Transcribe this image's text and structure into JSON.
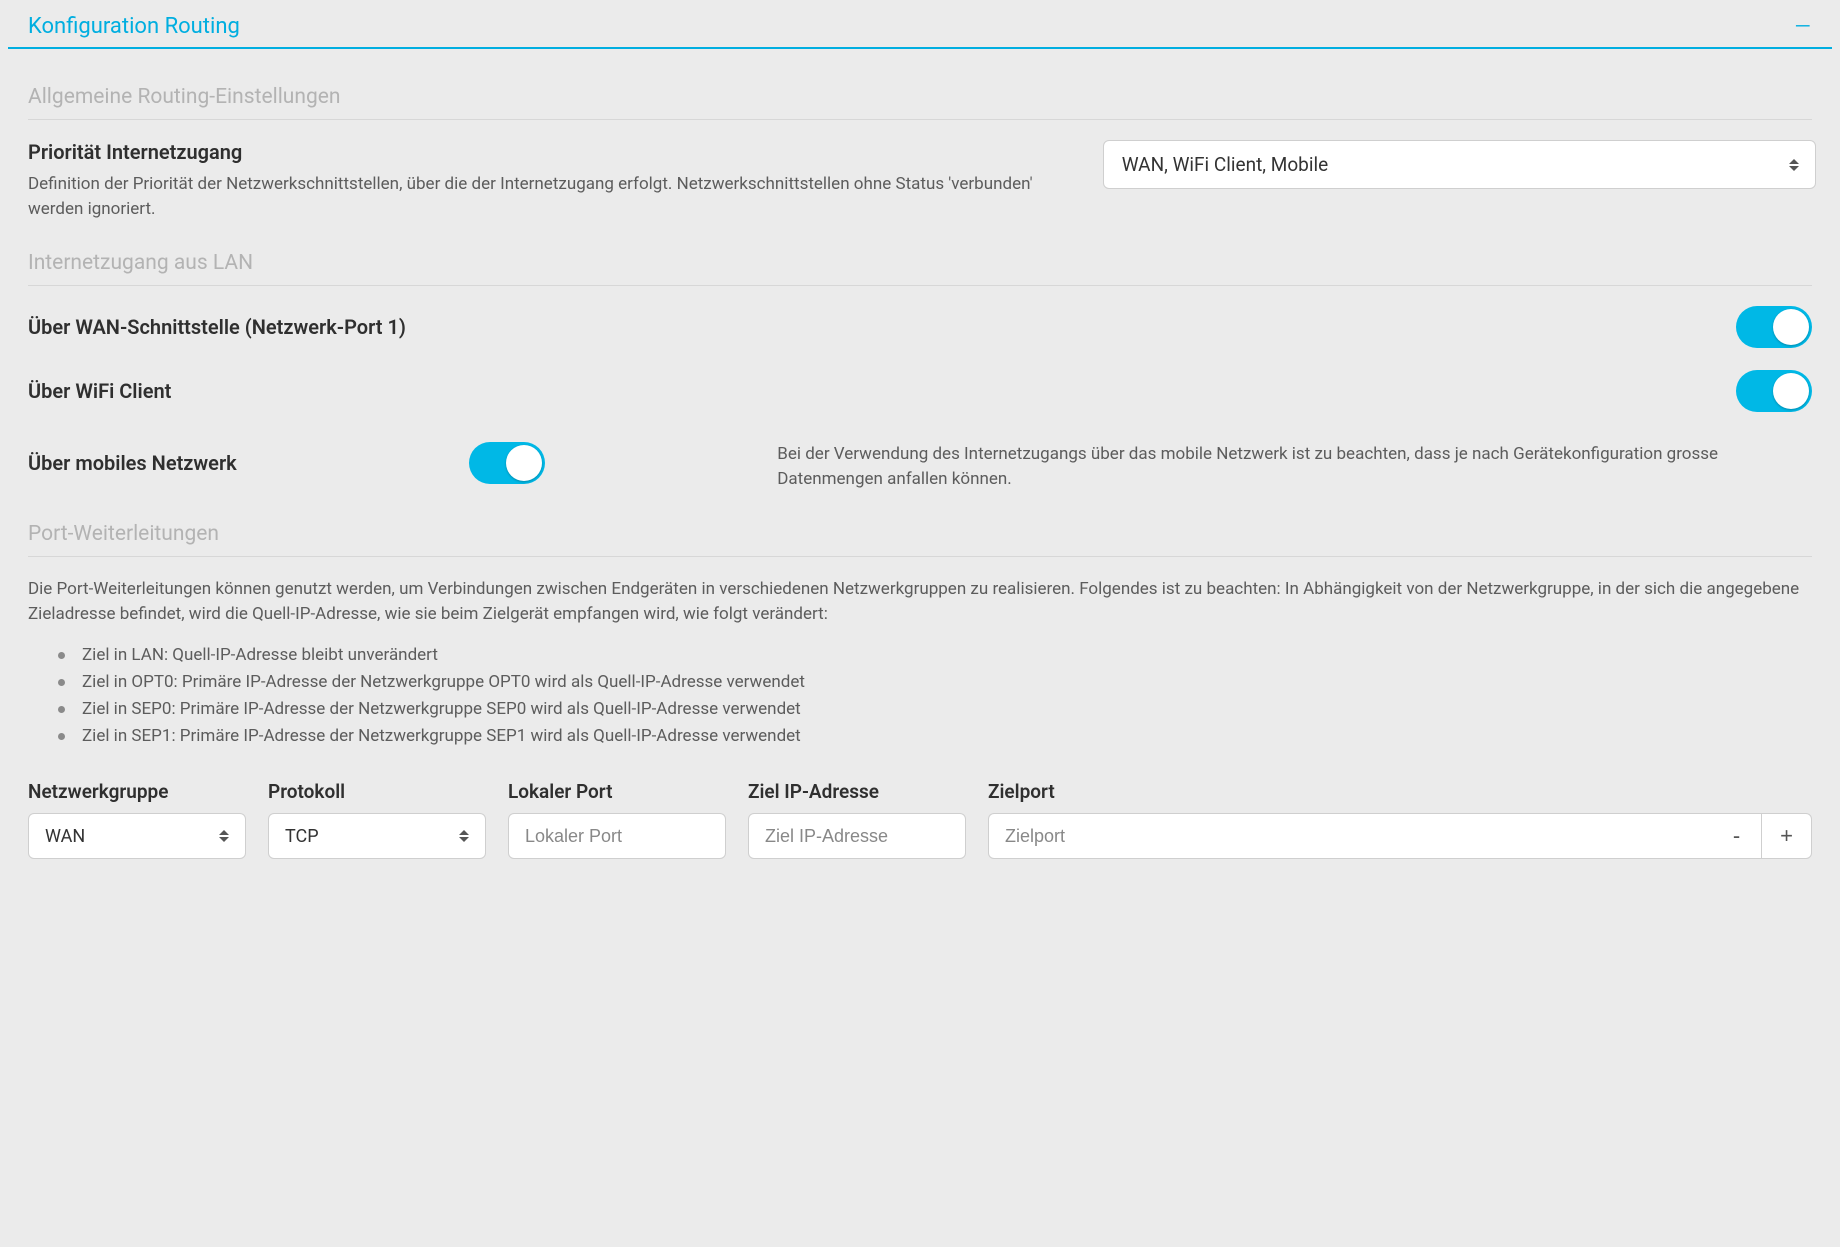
{
  "panel": {
    "title": "Konfiguration Routing"
  },
  "general": {
    "heading": "Allgemeine Routing-Einstellungen",
    "priority": {
      "label": "Priorität Internetzugang",
      "desc": "Definition der Priorität der Netzwerkschnittstellen, über die der Internetzugang erfolgt. Netzwerkschnittstellen ohne Status 'verbunden' werden ignoriert.",
      "value": "WAN, WiFi Client, Mobile"
    }
  },
  "lan": {
    "heading": "Internetzugang aus LAN",
    "wan": {
      "label": "Über WAN-Schnittstelle (Netzwerk-Port 1)",
      "value": true
    },
    "wifi": {
      "label": "Über WiFi Client",
      "value": true
    },
    "mobile": {
      "label": "Über mobiles Netzwerk",
      "desc": "Bei der Verwendung des Internetzugangs über das mobile Netzwerk ist zu beachten, dass je nach Gerätekonfiguration grosse Datenmengen anfallen können.",
      "value": true
    }
  },
  "pf": {
    "heading": "Port-Weiterleitungen",
    "intro": "Die Port-Weiterleitungen können genutzt werden, um Verbindungen zwischen Endgeräten in verschiedenen Netzwerkgruppen zu realisieren. Folgendes ist zu beachten: In Abhängigkeit von der Netzwerkgruppe, in der sich die angegebene Zieladresse befindet, wird die Quell-IP-Adresse, wie sie beim Zielgerät empfangen wird, wie folgt verändert:",
    "bullets": [
      "Ziel in LAN: Quell-IP-Adresse bleibt unverändert",
      "Ziel in OPT0: Primäre IP-Adresse der Netzwerkgruppe OPT0 wird als Quell-IP-Adresse verwendet",
      "Ziel in SEP0: Primäre IP-Adresse der Netzwerkgruppe SEP0 wird als Quell-IP-Adresse verwendet",
      "Ziel in SEP1: Primäre IP-Adresse der Netzwerkgruppe SEP1 wird als Quell-IP-Adresse verwendet"
    ],
    "form": {
      "netgroup": {
        "label": "Netzwerkgruppe",
        "value": "WAN"
      },
      "protocol": {
        "label": "Protokoll",
        "value": "TCP"
      },
      "localport": {
        "label": "Lokaler Port",
        "placeholder": "Lokaler Port"
      },
      "targetip": {
        "label": "Ziel IP-Adresse",
        "placeholder": "Ziel IP-Adresse"
      },
      "targetport": {
        "label": "Zielport",
        "placeholder": "Zielport"
      },
      "minus": "-",
      "plus": "+"
    }
  }
}
